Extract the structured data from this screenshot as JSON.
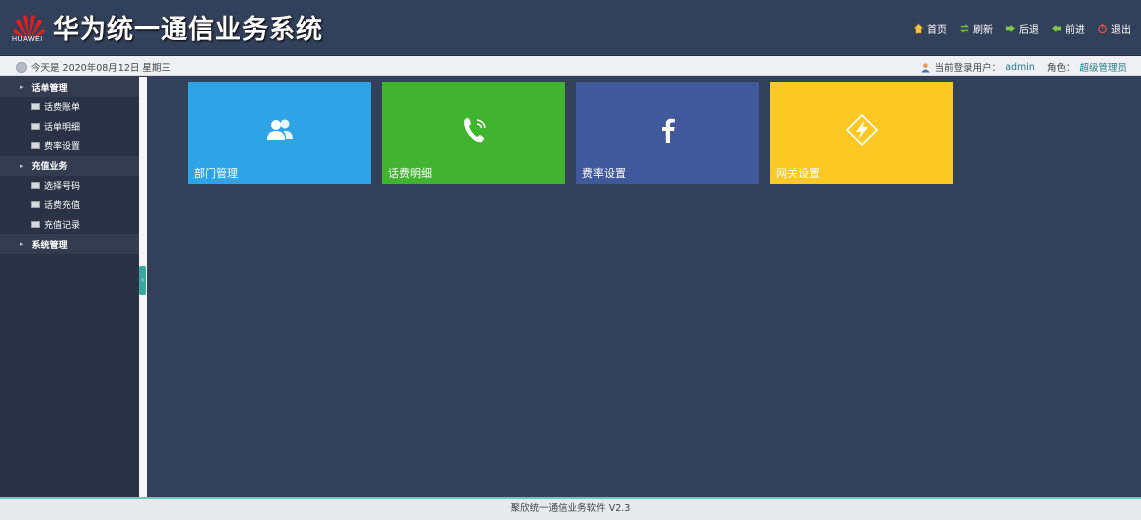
{
  "header": {
    "logo_text": "HUAWEI",
    "title": "华为统一通信业务系统",
    "nav": [
      {
        "label": "首页",
        "icon": "home-icon"
      },
      {
        "label": "刷新",
        "icon": "refresh-icon"
      },
      {
        "label": "后退",
        "icon": "back-icon"
      },
      {
        "label": "前进",
        "icon": "forward-icon"
      },
      {
        "label": "退出",
        "icon": "power-icon"
      }
    ]
  },
  "status": {
    "date_text": "今天是 2020年08月12日 星期三",
    "user_label": "当前登录用户：",
    "user_name": "admin",
    "role_label": "角色：",
    "role_name": "超级管理员"
  },
  "sidebar": {
    "groups": [
      {
        "label": "话单管理",
        "items": [
          "话费账单",
          "话单明细",
          "费率设置"
        ]
      },
      {
        "label": "充值业务",
        "items": [
          "选择号码",
          "话费充值",
          "充值记录"
        ]
      },
      {
        "label": "系统管理",
        "items": []
      }
    ]
  },
  "tiles": [
    {
      "label": "部门管理",
      "icon": "users-icon",
      "color": "#2da4e6"
    },
    {
      "label": "话费明细",
      "icon": "phone-icon",
      "color": "#41b42f"
    },
    {
      "label": "费率设置",
      "icon": "facebook-f-icon",
      "color": "#40589c"
    },
    {
      "label": "网关设置",
      "icon": "lightning-diamond-icon",
      "color": "#fbc824"
    }
  ],
  "footer": {
    "text": "聚欣统一通信业务软件 V2.3"
  }
}
